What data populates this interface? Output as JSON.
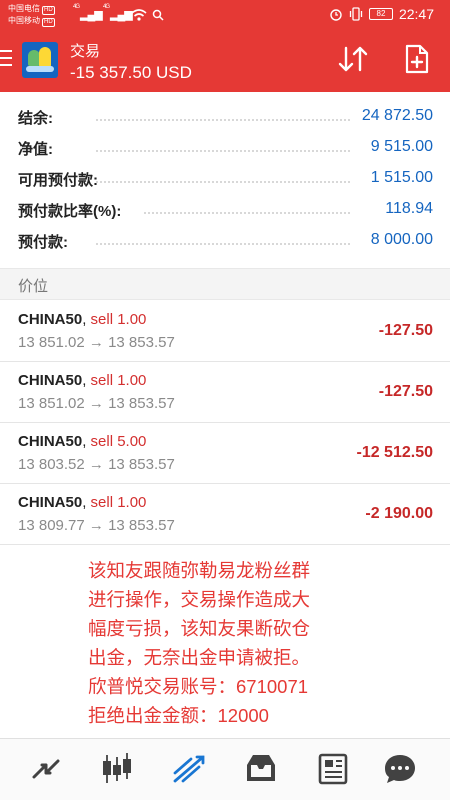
{
  "status_bar": {
    "carrier1": "中国电信",
    "carrier1_badge": "HD",
    "carrier2": "中国移动",
    "carrier2_badge": "HD",
    "network": "4G",
    "network2": "4G",
    "battery": "82",
    "time": "22:47",
    "icons": [
      "signal-icon",
      "wifi-icon",
      "search-icon",
      "alarm-icon",
      "vibrate-icon",
      "battery-icon"
    ]
  },
  "app_bar": {
    "title": "交易",
    "subtitle": "-15 357.50 USD",
    "icons": [
      "menu-icon",
      "app-logo",
      "sort-icon",
      "add-document-icon"
    ]
  },
  "account": [
    {
      "label": "结余:",
      "value": "24 872.50"
    },
    {
      "label": "净值:",
      "value": "9 515.00"
    },
    {
      "label": "可用预付款:",
      "value": "1 515.00"
    },
    {
      "label": "预付款比率(%):",
      "value": "118.94"
    },
    {
      "label": "预付款:",
      "value": "8 000.00"
    }
  ],
  "section": {
    "title": "价位"
  },
  "positions": [
    {
      "symbol": "CHINA50",
      "sep": ",",
      "action": "sell 1.00",
      "open": "13 851.02",
      "arrow": "→",
      "current": "13 853.57",
      "profit": "-127.50"
    },
    {
      "symbol": "CHINA50",
      "sep": ",",
      "action": "sell 1.00",
      "open": "13 851.02",
      "arrow": "→",
      "current": "13 853.57",
      "profit": "-127.50"
    },
    {
      "symbol": "CHINA50",
      "sep": ",",
      "action": "sell 5.00",
      "open": "13 803.52",
      "arrow": "→",
      "current": "13 853.57",
      "profit": "-12 512.50"
    },
    {
      "symbol": "CHINA50",
      "sep": ",",
      "action": "sell 1.00",
      "open": "13 809.77",
      "arrow": "→",
      "current": "13 853.57",
      "profit": "-2 190.00"
    }
  ],
  "overlay_text": [
    "该知友跟随弥勒易龙粉丝群",
    "进行操作，交易操作造成大",
    "幅度亏损，该知友果断砍仓",
    "出金，无奈出金申请被拒。",
    "欣普悦交易账号：6710071",
    "拒绝出金金额：12000"
  ],
  "bottom_nav": [
    "quotes-icon",
    "chart-icon",
    "trade-icon",
    "history-icon",
    "news-icon",
    "chat-icon"
  ],
  "colors": {
    "accent": "#e53935",
    "value_blue": "#1565c0",
    "loss_red": "#c62828",
    "muted": "#8a8a8a"
  }
}
